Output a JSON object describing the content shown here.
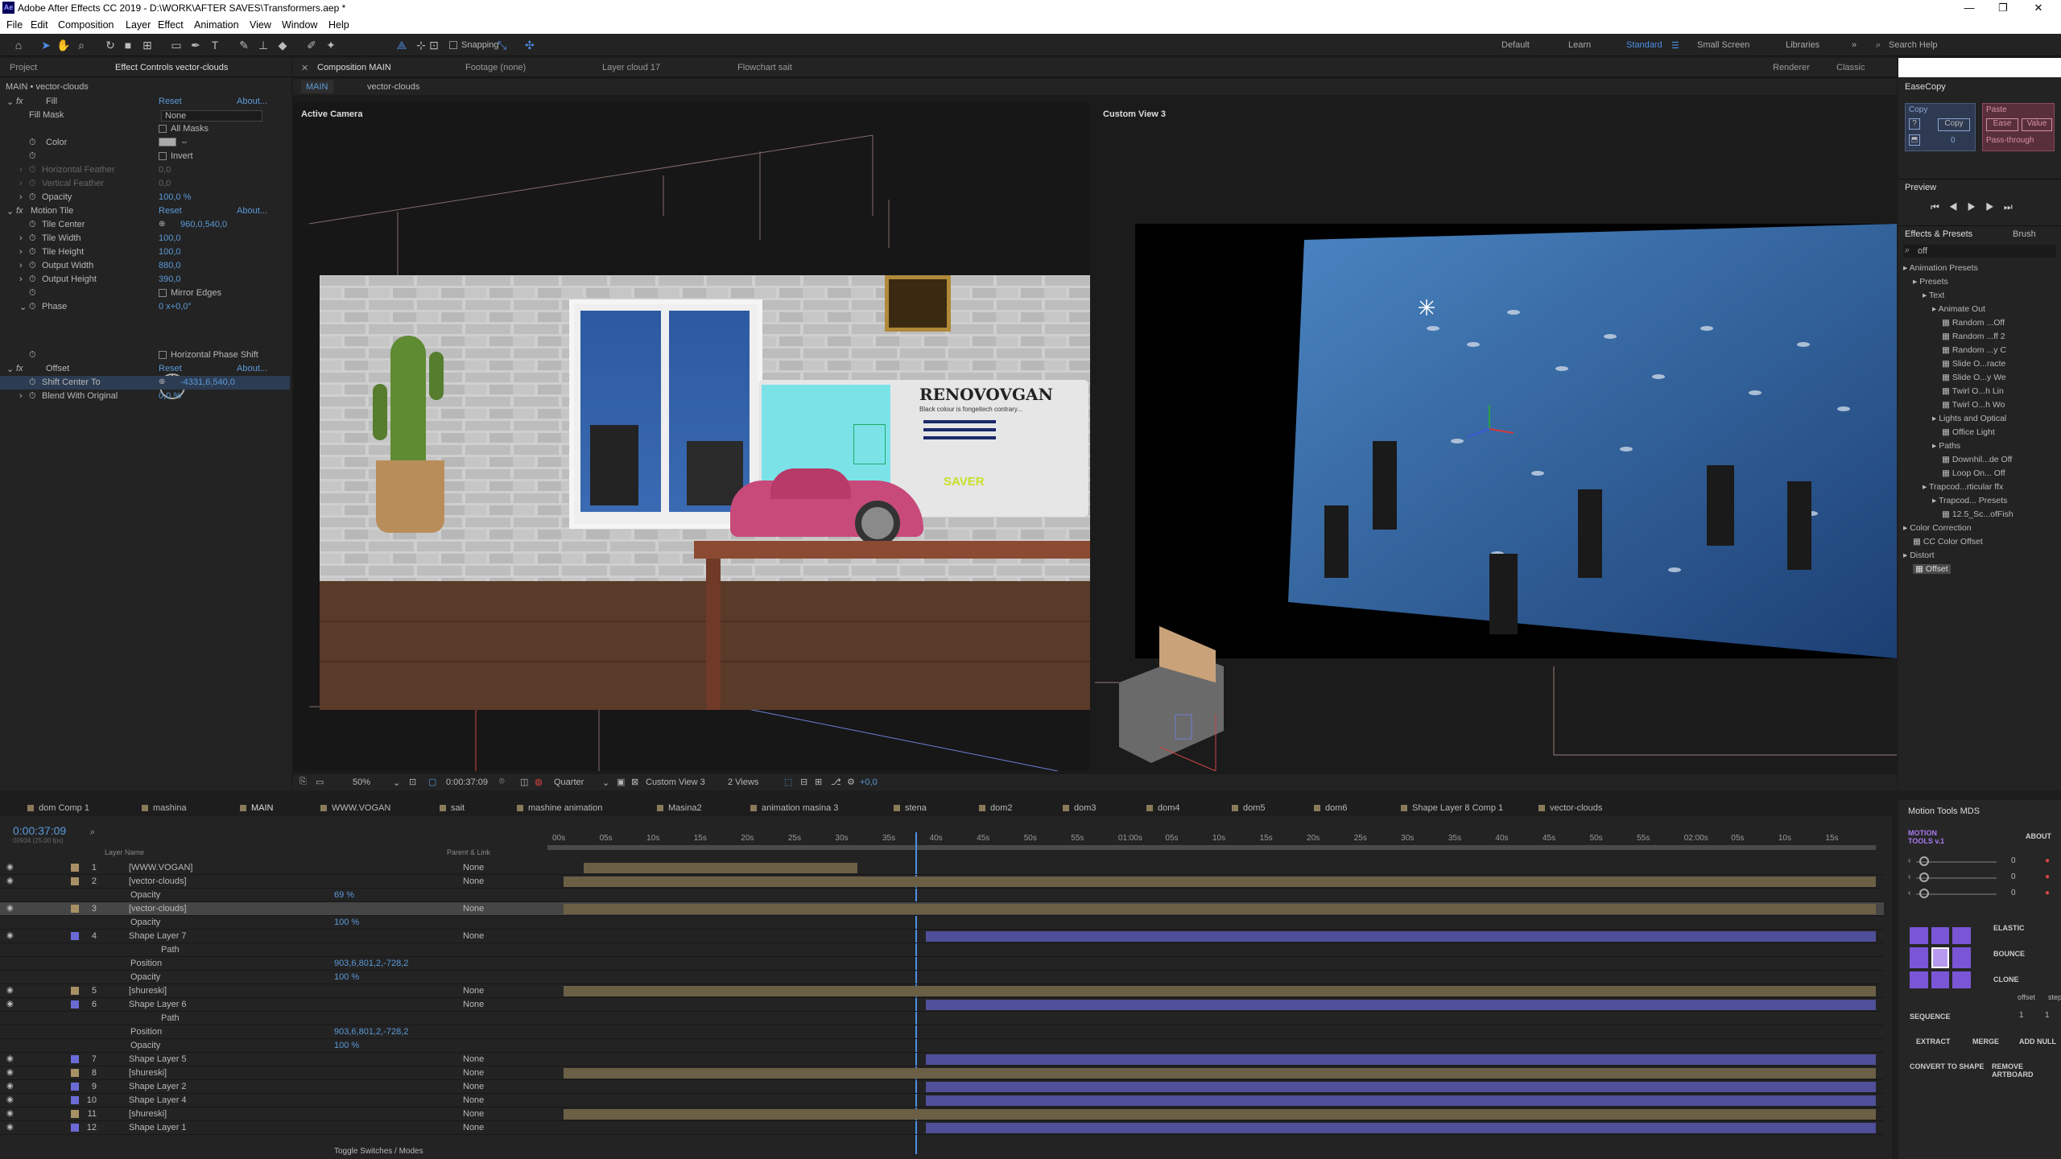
{
  "app": {
    "title": "Adobe After Effects CC 2019 - D:\\WORK\\AFTER SAVES\\Transformers.aep *",
    "logo": "Ae"
  },
  "menu": [
    "File",
    "Edit",
    "Composition",
    "Layer",
    "Effect",
    "Animation",
    "View",
    "Window",
    "Help"
  ],
  "toolbar": {
    "snapping": "Snapping",
    "workspaces": [
      "Default",
      "Learn",
      "Standard",
      "Small Screen",
      "Libraries"
    ],
    "search_placeholder": "Search Help"
  },
  "left_panel": {
    "tabs": [
      "Project",
      "Effect Controls vector-clouds"
    ],
    "header": "MAIN • vector-clouds",
    "fill": {
      "name": "Fill",
      "reset": "Reset",
      "about": "About...",
      "fill_mask_label": "Fill Mask",
      "fill_mask_value": "None",
      "all_masks": "All Masks",
      "color": "Color",
      "invert": "Invert",
      "hfeather": "Horizontal Feather",
      "hfeather_v": "0,0",
      "vfeather": "Vertical Feather",
      "vfeather_v": "0,0",
      "opacity": "Opacity",
      "opacity_v": "100,0 %"
    },
    "motion_tile": {
      "name": "Motion Tile",
      "reset": "Reset",
      "about": "About...",
      "rows": [
        {
          "label": "Tile Center",
          "value": "960,0,540,0"
        },
        {
          "label": "Tile Width",
          "value": "100,0"
        },
        {
          "label": "Tile Height",
          "value": "100,0"
        },
        {
          "label": "Output Width",
          "value": "880,0"
        },
        {
          "label": "Output Height",
          "value": "390,0"
        }
      ],
      "mirror": "Mirror Edges",
      "phase": "Phase",
      "phase_v": "0 x+0,0°",
      "hphase": "Horizontal Phase Shift"
    },
    "offset": {
      "name": "Offset",
      "reset": "Reset",
      "about": "About...",
      "shift_label": "Shift Center To",
      "shift_v": "-4331,6,540,0",
      "blend_label": "Blend With Original",
      "blend_v": "0,0 %"
    }
  },
  "center": {
    "tabs": [
      "Composition MAIN",
      "Footage (none)",
      "Layer cloud 17",
      "Flowchart sait"
    ],
    "sub_tabs": [
      "MAIN",
      "vector-clouds"
    ],
    "renderer": "Renderer",
    "classic": "Classic",
    "left_view_label": "Active Camera",
    "right_view_label": "Custom View 3",
    "sign_title": "RENOVOVGAN",
    "sign_sub": "Black colour is fongeitech contrary...",
    "saver": "SAVER",
    "footer": {
      "zoom": "50%",
      "time": "0:00:37:09",
      "quality": "Quarter",
      "view": "Custom View 3",
      "views": "2 Views",
      "offset": "+0,0"
    }
  },
  "right_panel": {
    "easecopy": {
      "title": "EaseCopy",
      "copy_header": "Copy",
      "copy_btn": "Copy",
      "copy_q": "?",
      "copy_zero": "0",
      "paste_header": "Paste",
      "ease_btn": "Ease",
      "value_btn": "Value",
      "pass_through": "Pass-through"
    },
    "preview": "Preview",
    "effects_tab": "Effects & Presets",
    "brush_tab": "Brush",
    "search_value": "off",
    "tree": [
      {
        "t": "Animation Presets",
        "d": 0
      },
      {
        "t": "Presets",
        "d": 1
      },
      {
        "t": "Text",
        "d": 2
      },
      {
        "t": "Animate Out",
        "d": 3
      },
      {
        "t": "Random ...Off",
        "d": 4
      },
      {
        "t": "Random ...ff 2",
        "d": 4
      },
      {
        "t": "Random ...y C",
        "d": 4
      },
      {
        "t": "Slide O...racte",
        "d": 4
      },
      {
        "t": "Slide O...y We",
        "d": 4
      },
      {
        "t": "Twirl O...h Lin",
        "d": 4
      },
      {
        "t": "Twirl O...h Wo",
        "d": 4
      },
      {
        "t": "Lights and Optical",
        "d": 3
      },
      {
        "t": "Office Light",
        "d": 4
      },
      {
        "t": "Paths",
        "d": 3
      },
      {
        "t": "Downhil...de Off",
        "d": 4
      },
      {
        "t": "Loop On... Off",
        "d": 4
      },
      {
        "t": "Trapcod...rticular ffx",
        "d": 2
      },
      {
        "t": "Trapcod... Presets",
        "d": 3
      },
      {
        "t": "12.5_Sc...ofFish",
        "d": 4
      },
      {
        "t": "Color Correction",
        "d": 0
      },
      {
        "t": "CC Color Offset",
        "d": 1
      },
      {
        "t": "Distort",
        "d": 0
      },
      {
        "t": "Offset",
        "d": 1
      }
    ]
  },
  "timeline": {
    "tabs": [
      "dom Comp 1",
      "mashina",
      "MAIN",
      "WWW.VOGAN",
      "sait",
      "mashine animation",
      "Masina2",
      "animation masina 3",
      "stena",
      "dom2",
      "dom3",
      "dom4",
      "dom5",
      "dom6",
      "Shape Layer 8 Comp 1",
      "vector-clouds"
    ],
    "timecode": "0:00:37:09",
    "timecode_sub": "00934 (25.00 fps)",
    "col_layer_name": "Layer Name",
    "col_parent": "Parent & Link",
    "ruler": [
      "00s",
      "05s",
      "10s",
      "15s",
      "20s",
      "25s",
      "30s",
      "35s",
      "40s",
      "45s",
      "50s",
      "55s",
      "01:00s",
      "05s",
      "10s",
      "15s",
      "20s",
      "25s",
      "30s",
      "35s",
      "40s",
      "45s",
      "50s",
      "55s",
      "02:00s",
      "05s",
      "10s",
      "15s"
    ],
    "layers": [
      {
        "num": "1",
        "name": "[WWW.VOGAN]",
        "parent": "None",
        "kind": "layer",
        "color": "#a89065"
      },
      {
        "num": "2",
        "name": "[vector-clouds]",
        "parent": "None",
        "kind": "layer",
        "color": "#a89065"
      },
      {
        "num": "",
        "name": "Opacity",
        "parent": "",
        "kind": "prop",
        "value": "69 %"
      },
      {
        "num": "3",
        "name": "[vector-clouds]",
        "parent": "None",
        "kind": "layer",
        "color": "#a89065",
        "selected": true
      },
      {
        "num": "",
        "name": "Opacity",
        "parent": "",
        "kind": "prop",
        "value": "100 %"
      },
      {
        "num": "4",
        "name": "Shape Layer 7",
        "parent": "None",
        "kind": "layer",
        "color": "#6b6bd6"
      },
      {
        "num": "",
        "name": "Path",
        "parent": "",
        "kind": "prop2",
        "value": ""
      },
      {
        "num": "",
        "name": "Position",
        "parent": "",
        "kind": "prop",
        "value": "903,6,801,2,-728,2"
      },
      {
        "num": "",
        "name": "Opacity",
        "parent": "",
        "kind": "prop",
        "value": "100 %"
      },
      {
        "num": "5",
        "name": "[shureski]",
        "parent": "None",
        "kind": "layer",
        "color": "#a89065"
      },
      {
        "num": "6",
        "name": "Shape Layer 6",
        "parent": "None",
        "kind": "layer",
        "color": "#6b6bd6"
      },
      {
        "num": "",
        "name": "Path",
        "parent": "",
        "kind": "prop2",
        "value": ""
      },
      {
        "num": "",
        "name": "Position",
        "parent": "",
        "kind": "prop",
        "value": "903,6,801,2,-728,2"
      },
      {
        "num": "",
        "name": "Opacity",
        "parent": "",
        "kind": "prop",
        "value": "100 %"
      },
      {
        "num": "7",
        "name": "Shape Layer 5",
        "parent": "None",
        "kind": "layer",
        "color": "#6b6bd6"
      },
      {
        "num": "8",
        "name": "[shureski]",
        "parent": "None",
        "kind": "layer",
        "color": "#a89065"
      },
      {
        "num": "9",
        "name": "Shape Layer 2",
        "parent": "None",
        "kind": "layer",
        "color": "#6b6bd6"
      },
      {
        "num": "10",
        "name": "Shape Layer 4",
        "parent": "None",
        "kind": "layer",
        "color": "#6b6bd6"
      },
      {
        "num": "11",
        "name": "[shureski]",
        "parent": "None",
        "kind": "layer",
        "color": "#a89065"
      },
      {
        "num": "12",
        "name": "Shape Layer 1",
        "parent": "None",
        "kind": "layer",
        "color": "#6b6bd6"
      }
    ],
    "toggle": "Toggle Switches / Modes"
  },
  "motion_tools": {
    "title": "Motion Tools MDS",
    "logo": "MOTION TOOLS v.1",
    "about": "ABOUT",
    "sliders": [
      "0",
      "0",
      "0"
    ],
    "elastic": "ELASTIC",
    "bounce": "BOUNCE",
    "clone": "CLONE",
    "offset": "offset",
    "step": "step",
    "sequence": "SEQUENCE",
    "seq_vals": [
      "1",
      "1"
    ],
    "extract": "EXTRACT",
    "merge": "MERGE",
    "add_null": "ADD NULL",
    "convert": "CONVERT TO SHAPE",
    "remove": "REMOVE ARTBOARD"
  }
}
